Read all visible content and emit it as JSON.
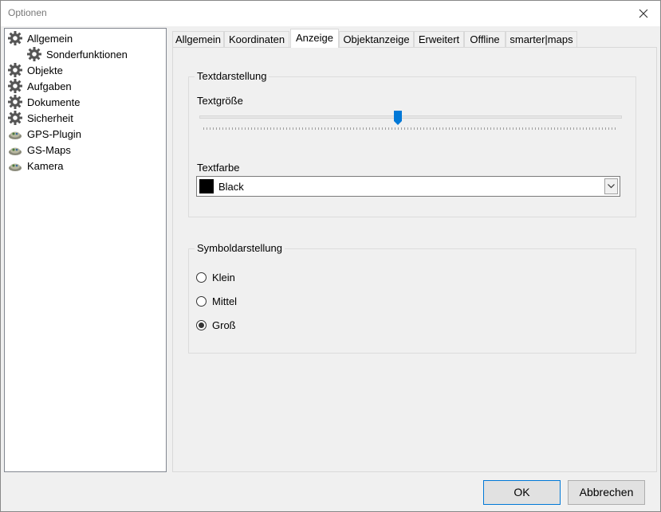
{
  "window": {
    "title": "Optionen",
    "close_icon": "close-icon"
  },
  "tree": {
    "items": [
      {
        "label": "Allgemein",
        "icon": "gear-icon"
      },
      {
        "label": "Sonderfunktionen",
        "icon": "gear-icon"
      },
      {
        "label": "Objekte",
        "icon": "gear-icon"
      },
      {
        "label": "Aufgaben",
        "icon": "gear-icon"
      },
      {
        "label": "Dokumente",
        "icon": "gear-icon"
      },
      {
        "label": "Sicherheit",
        "icon": "gear-icon"
      },
      {
        "label": "GPS-Plugin",
        "icon": "plugin-icon"
      },
      {
        "label": "GS-Maps",
        "icon": "plugin-icon"
      },
      {
        "label": "Kamera",
        "icon": "plugin-icon"
      }
    ]
  },
  "tabs": [
    {
      "label": "Allgemein"
    },
    {
      "label": "Koordinaten"
    },
    {
      "label": "Anzeige"
    },
    {
      "label": "Objektanzeige"
    },
    {
      "label": "Erweitert"
    },
    {
      "label": "Offline"
    },
    {
      "label": "smarter|maps"
    }
  ],
  "active_tab": "Anzeige",
  "text_group": {
    "title": "Textdarstellung",
    "size_label": "Textgröße",
    "size_level": 0.47,
    "color_label": "Textfarbe",
    "color_value": "Black",
    "color_hex": "#000000"
  },
  "symbol_group": {
    "title": "Symboldarstellung",
    "options": [
      "Klein",
      "Mittel",
      "Groß"
    ],
    "selected": "Groß"
  },
  "buttons": {
    "ok": "OK",
    "cancel": "Abbrechen"
  },
  "colors": {
    "accent": "#0078d7",
    "window_bg": "#f0f0f0"
  }
}
